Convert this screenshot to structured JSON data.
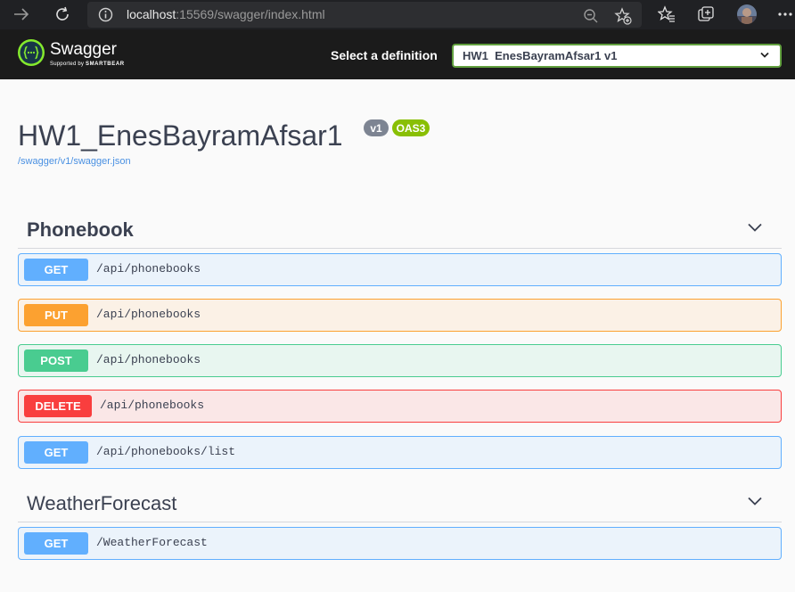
{
  "browser": {
    "url_host": "localhost",
    "url_rest": ":15569/swagger/index.html"
  },
  "topbar": {
    "logo_text": "Swagger",
    "logo_sub_prefix": "Supported by",
    "logo_sub_brand": "SMARTBEAR",
    "definition_label": "Select a definition",
    "definition_selected": "HW1  EnesBayramAfsar1 v1"
  },
  "info": {
    "title": "HW1_EnesBayramAfsar1",
    "version_badge": "v1",
    "oas_badge": "OAS3",
    "spec_link": "/swagger/v1/swagger.json"
  },
  "tags": [
    {
      "name": "Phonebook",
      "operations": [
        {
          "method": "GET",
          "path": "/api/phonebooks"
        },
        {
          "method": "PUT",
          "path": "/api/phonebooks"
        },
        {
          "method": "POST",
          "path": "/api/phonebooks"
        },
        {
          "method": "DELETE",
          "path": "/api/phonebooks"
        },
        {
          "method": "GET",
          "path": "/api/phonebooks/list"
        }
      ]
    },
    {
      "name": "WeatherForecast",
      "operations": [
        {
          "method": "GET",
          "path": "/WeatherForecast"
        }
      ]
    }
  ],
  "colors": {
    "get": "#61affe",
    "put": "#fca130",
    "post": "#49cc90",
    "delete": "#f93e3e",
    "accent": "#89bf04"
  }
}
